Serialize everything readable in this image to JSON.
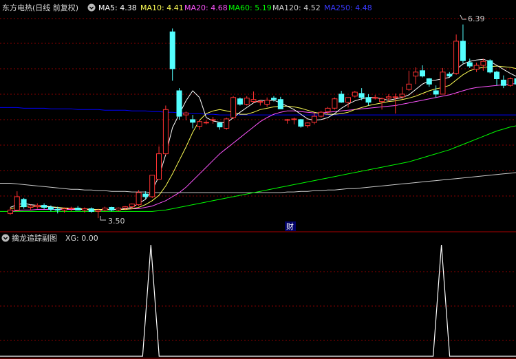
{
  "colors": {
    "background": "#000000",
    "up": "#ff3232",
    "down": "#54ffff",
    "grid": "#8b0000",
    "ma5": "#ffffff",
    "ma10": "#ffff55",
    "ma20": "#ff55ff",
    "ma60": "#00ff00",
    "ma120": "#cccccc",
    "ma250": "#0000ff",
    "xg": "#ffffff"
  },
  "main_header": {
    "title": "东方电热(日线 前复权)",
    "menu_icon": "circle-chevron-down-icon",
    "ma5_label": "MA5: 4.38",
    "ma10_label": "MA10: 4.41",
    "ma20_label": "MA20: 4.68",
    "ma60_label": "MA60: 5.19",
    "ma120_label": "MA120: 4.52",
    "ma250_label": "MA250: 4.48"
  },
  "sub_header": {
    "title": "擒龙追踪副图",
    "xg_label": "XG: 0.00",
    "menu_icon": "circle-chevron-down-icon"
  },
  "annotations": {
    "high_label": "6.39",
    "low_label": "3.50",
    "finance_marker": "财"
  },
  "chart_data": [
    {
      "type": "candlestick",
      "title": "东方电热(日线 前复权)",
      "ylim": [
        3.45,
        6.55
      ],
      "candles": [
        [
          3.57,
          3.66,
          3.55,
          3.62
        ],
        [
          3.62,
          3.9,
          3.6,
          3.82
        ],
        [
          3.78,
          3.8,
          3.64,
          3.67
        ],
        [
          3.66,
          3.7,
          3.62,
          3.68
        ],
        [
          3.67,
          3.72,
          3.64,
          3.69
        ],
        [
          3.69,
          3.72,
          3.63,
          3.66
        ],
        [
          3.66,
          3.69,
          3.6,
          3.63
        ],
        [
          3.63,
          3.67,
          3.57,
          3.62
        ],
        [
          3.62,
          3.66,
          3.58,
          3.64
        ],
        [
          3.64,
          3.67,
          3.6,
          3.65
        ],
        [
          3.65,
          3.68,
          3.62,
          3.62
        ],
        [
          3.62,
          3.66,
          3.58,
          3.64
        ],
        [
          3.64,
          3.66,
          3.58,
          3.6
        ],
        [
          3.6,
          3.64,
          3.5,
          3.62
        ],
        [
          3.62,
          3.67,
          3.6,
          3.65
        ],
        [
          3.66,
          3.67,
          3.6,
          3.62
        ],
        [
          3.62,
          3.66,
          3.6,
          3.65
        ],
        [
          3.65,
          3.68,
          3.62,
          3.67
        ],
        [
          3.67,
          3.72,
          3.63,
          3.71
        ],
        [
          3.7,
          3.92,
          3.68,
          3.88
        ],
        [
          3.86,
          3.9,
          3.79,
          3.82
        ],
        [
          3.82,
          4.12,
          3.8,
          4.14
        ],
        [
          4.08,
          4.57,
          4.08,
          4.46
        ],
        [
          4.46,
          5.18,
          4.44,
          5.12
        ],
        [
          6.28,
          6.33,
          5.55,
          5.73
        ],
        [
          5.4,
          5.44,
          4.97,
          5.02
        ],
        [
          5.04,
          5.09,
          4.96,
          5.07
        ],
        [
          4.97,
          5.04,
          4.84,
          4.93
        ],
        [
          4.87,
          4.96,
          4.82,
          4.94
        ],
        [
          4.93,
          4.96,
          4.9,
          4.93
        ],
        [
          4.96,
          5.01,
          4.91,
          4.97
        ],
        [
          4.92,
          4.93,
          4.82,
          4.86
        ],
        [
          4.84,
          5.0,
          4.82,
          4.98
        ],
        [
          5.0,
          5.32,
          4.98,
          5.3
        ],
        [
          5.28,
          5.3,
          5.18,
          5.2
        ],
        [
          5.2,
          5.32,
          5.18,
          5.29
        ],
        [
          5.24,
          5.39,
          5.22,
          5.27
        ],
        [
          5.23,
          5.26,
          5.18,
          5.24
        ],
        [
          5.2,
          5.3,
          5.16,
          5.26
        ],
        [
          5.29,
          5.32,
          5.24,
          5.27
        ],
        [
          5.27,
          5.31,
          5.14,
          5.13
        ],
        [
          4.97,
          4.98,
          4.91,
          4.97
        ],
        [
          4.98,
          5.0,
          4.9,
          4.98
        ],
        [
          4.97,
          4.98,
          4.85,
          4.87
        ],
        [
          4.88,
          4.93,
          4.85,
          4.92
        ],
        [
          4.93,
          5.06,
          4.9,
          5.02
        ],
        [
          5.02,
          5.1,
          5.0,
          5.08
        ],
        [
          5.09,
          5.16,
          5.04,
          5.14
        ],
        [
          5.14,
          5.3,
          5.12,
          5.28
        ],
        [
          5.35,
          5.4,
          5.22,
          5.23
        ],
        [
          5.23,
          5.3,
          5.15,
          5.3
        ],
        [
          5.32,
          5.4,
          5.3,
          5.38
        ],
        [
          5.36,
          5.44,
          5.26,
          5.3
        ],
        [
          5.3,
          5.35,
          5.18,
          5.23
        ],
        [
          5.3,
          5.34,
          5.27,
          5.3
        ],
        [
          5.24,
          5.3,
          5.12,
          5.28
        ],
        [
          5.29,
          5.35,
          5.24,
          5.31
        ],
        [
          5.3,
          5.36,
          5.06,
          5.31
        ],
        [
          5.31,
          5.46,
          5.28,
          5.35
        ],
        [
          5.42,
          5.7,
          5.4,
          5.5
        ],
        [
          5.62,
          5.75,
          5.5,
          5.68
        ],
        [
          5.7,
          5.78,
          5.6,
          5.62
        ],
        [
          5.58,
          5.59,
          5.46,
          5.5
        ],
        [
          5.4,
          5.48,
          5.3,
          5.35
        ],
        [
          5.35,
          5.74,
          5.35,
          5.68
        ],
        [
          5.65,
          5.68,
          5.6,
          5.62
        ],
        [
          5.66,
          6.24,
          5.64,
          6.14
        ],
        [
          6.14,
          6.39,
          5.81,
          5.85
        ],
        [
          5.82,
          5.88,
          5.74,
          5.77
        ],
        [
          5.72,
          5.82,
          5.68,
          5.78
        ],
        [
          5.78,
          5.88,
          5.7,
          5.84
        ],
        [
          5.85,
          5.87,
          5.66,
          5.68
        ],
        [
          5.68,
          5.7,
          5.48,
          5.58
        ],
        [
          5.56,
          5.63,
          5.44,
          5.48
        ],
        [
          5.48,
          5.6,
          5.46,
          5.58
        ],
        [
          5.58,
          5.64,
          5.48,
          5.5
        ]
      ],
      "ma5": [
        3.66,
        3.7,
        3.72,
        3.7,
        3.69,
        3.68,
        3.67,
        3.65,
        3.64,
        3.64,
        3.63,
        3.63,
        3.62,
        3.62,
        3.62,
        3.63,
        3.63,
        3.64,
        3.66,
        3.72,
        3.78,
        3.92,
        4.12,
        4.45,
        4.85,
        5.05,
        5.25,
        5.4,
        5.3,
        5.0,
        4.95,
        4.93,
        4.92,
        5.0,
        5.08,
        5.15,
        5.22,
        5.26,
        5.25,
        5.26,
        5.22,
        5.17,
        5.12,
        5.05,
        4.98,
        4.96,
        4.97,
        5.0,
        5.06,
        5.14,
        5.2,
        5.25,
        5.28,
        5.3,
        5.3,
        5.28,
        5.26,
        5.28,
        5.3,
        5.34,
        5.42,
        5.5,
        5.55,
        5.56,
        5.58,
        5.6,
        5.72,
        5.8,
        5.84,
        5.86,
        5.87,
        5.84,
        5.78,
        5.72,
        5.66,
        5.61
      ],
      "ma10": [
        3.64,
        3.66,
        3.68,
        3.68,
        3.67,
        3.67,
        3.67,
        3.66,
        3.65,
        3.65,
        3.64,
        3.64,
        3.63,
        3.63,
        3.63,
        3.63,
        3.63,
        3.63,
        3.64,
        3.66,
        3.7,
        3.76,
        3.84,
        3.98,
        4.16,
        4.36,
        4.56,
        4.78,
        4.96,
        5.06,
        5.1,
        5.12,
        5.1,
        5.08,
        5.05,
        5.05,
        5.08,
        5.12,
        5.14,
        5.16,
        5.17,
        5.17,
        5.16,
        5.14,
        5.11,
        5.08,
        5.06,
        5.05,
        5.05,
        5.06,
        5.08,
        5.12,
        5.15,
        5.18,
        5.2,
        5.22,
        5.24,
        5.25,
        5.27,
        5.29,
        5.32,
        5.36,
        5.4,
        5.43,
        5.45,
        5.48,
        5.56,
        5.64,
        5.7,
        5.73,
        5.75,
        5.76,
        5.77,
        5.76,
        5.75,
        5.73
      ],
      "ma20": [
        3.6,
        3.61,
        3.62,
        3.62,
        3.63,
        3.63,
        3.63,
        3.63,
        3.63,
        3.63,
        3.63,
        3.63,
        3.63,
        3.63,
        3.63,
        3.63,
        3.63,
        3.63,
        3.64,
        3.64,
        3.66,
        3.68,
        3.72,
        3.76,
        3.82,
        3.88,
        3.96,
        4.06,
        4.16,
        4.26,
        4.36,
        4.46,
        4.54,
        4.62,
        4.7,
        4.78,
        4.86,
        4.94,
        5.0,
        5.05,
        5.08,
        5.1,
        5.1,
        5.09,
        5.08,
        5.07,
        5.07,
        5.08,
        5.09,
        5.1,
        5.11,
        5.12,
        5.13,
        5.14,
        5.15,
        5.16,
        5.17,
        5.18,
        5.2,
        5.22,
        5.24,
        5.26,
        5.28,
        5.3,
        5.32,
        5.34,
        5.37,
        5.4,
        5.43,
        5.45,
        5.46,
        5.47,
        5.48,
        5.49,
        5.5,
        5.51
      ],
      "ma60": [
        3.6,
        3.6,
        3.6,
        3.6,
        3.6,
        3.6,
        3.6,
        3.6,
        3.6,
        3.6,
        3.6,
        3.6,
        3.6,
        3.6,
        3.6,
        3.6,
        3.6,
        3.6,
        3.6,
        3.6,
        3.6,
        3.6,
        3.61,
        3.62,
        3.64,
        3.66,
        3.68,
        3.7,
        3.72,
        3.74,
        3.76,
        3.78,
        3.8,
        3.82,
        3.84,
        3.86,
        3.88,
        3.9,
        3.92,
        3.94,
        3.96,
        3.98,
        4.0,
        4.02,
        4.04,
        4.06,
        4.08,
        4.1,
        4.12,
        4.14,
        4.16,
        4.18,
        4.2,
        4.22,
        4.24,
        4.26,
        4.28,
        4.3,
        4.32,
        4.34,
        4.37,
        4.4,
        4.43,
        4.46,
        4.49,
        4.52,
        4.56,
        4.6,
        4.64,
        4.68,
        4.72,
        4.76,
        4.8,
        4.83,
        4.86,
        4.88
      ],
      "ma120": [
        4.02,
        4.01,
        4.0,
        3.99,
        3.98,
        3.97,
        3.96,
        3.95,
        3.94,
        3.93,
        3.93,
        3.92,
        3.92,
        3.91,
        3.91,
        3.9,
        3.9,
        3.9,
        3.89,
        3.89,
        3.89,
        3.88,
        3.88,
        3.88,
        3.88,
        3.88,
        3.88,
        3.88,
        3.88,
        3.88,
        3.88,
        3.88,
        3.88,
        3.88,
        3.88,
        3.88,
        3.88,
        3.88,
        3.88,
        3.88,
        3.88,
        3.89,
        3.89,
        3.9,
        3.9,
        3.91,
        3.91,
        3.92,
        3.92,
        3.93,
        3.94,
        3.94,
        3.95,
        3.96,
        3.97,
        3.98,
        3.99,
        4.0,
        4.01,
        4.02,
        4.03,
        4.04,
        4.05,
        4.06,
        4.07,
        4.08,
        4.09,
        4.1,
        4.11,
        4.12,
        4.13,
        4.14,
        4.15,
        4.16,
        4.17,
        4.18
      ],
      "ma250": [
        5.15,
        5.15,
        5.14,
        5.14,
        5.14,
        5.14,
        5.13,
        5.13,
        5.13,
        5.13,
        5.12,
        5.12,
        5.12,
        5.12,
        5.11,
        5.11,
        5.11,
        5.11,
        5.1,
        5.1,
        5.1,
        5.09,
        5.09,
        5.08,
        5.08,
        5.07,
        5.07,
        5.06,
        5.06,
        5.05,
        5.05,
        5.04,
        5.04,
        5.04,
        5.04,
        5.04,
        5.04,
        5.04,
        5.04,
        5.04,
        5.04,
        5.04,
        5.04,
        5.04,
        5.04,
        5.04,
        5.04,
        5.04,
        5.04,
        5.04,
        5.04,
        5.04,
        5.04,
        5.04,
        5.04,
        5.04,
        5.04,
        5.04,
        5.04,
        5.04,
        5.04,
        5.04,
        5.04,
        5.04,
        5.04,
        5.04,
        5.04,
        5.04,
        5.04,
        5.04,
        5.04,
        5.04,
        5.04,
        5.04,
        5.04,
        5.04
      ]
    },
    {
      "type": "line",
      "title": "擒龙追踪副图",
      "ylim": [
        0,
        1
      ],
      "series": [
        {
          "name": "XG",
          "signal_days": [
            20,
            63
          ]
        }
      ]
    }
  ]
}
